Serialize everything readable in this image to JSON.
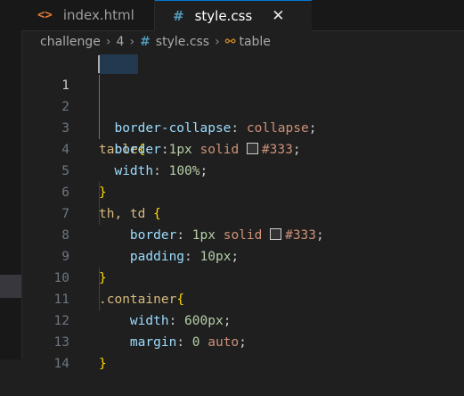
{
  "tabs": [
    {
      "label": "index.html",
      "icon": "html-file-icon",
      "active": false
    },
    {
      "label": "style.css",
      "icon": "css-file-icon",
      "active": true
    }
  ],
  "breadcrumb": {
    "items": [
      "challenge",
      "4",
      "style.css",
      "table"
    ]
  },
  "colors": {
    "selector": "#d7ba7d",
    "property": "#9cdcfe",
    "number": "#b5cea8",
    "string_value": "#ce9178",
    "brace": "#ffd700",
    "swatch": "#333333"
  },
  "editor": {
    "active_line": 1,
    "lines": [
      {
        "n": "1",
        "text": "table{"
      },
      {
        "n": "2",
        "text": "  border-collapse: collapse;"
      },
      {
        "n": "3",
        "text": "  border:1px solid #333;"
      },
      {
        "n": "4",
        "text": "  width: 100%;"
      },
      {
        "n": "5",
        "text": "}"
      },
      {
        "n": "6",
        "text": "th, td {"
      },
      {
        "n": "7",
        "text": "    border: 1px solid #333;"
      },
      {
        "n": "8",
        "text": "    padding: 10px;"
      },
      {
        "n": "9",
        "text": "}"
      },
      {
        "n": "10",
        "text": ".container{"
      },
      {
        "n": "11",
        "text": "    width: 600px;"
      },
      {
        "n": "12",
        "text": "    margin: 0 auto;"
      },
      {
        "n": "13",
        "text": "}"
      },
      {
        "n": "14",
        "text": ""
      }
    ],
    "tokens": {
      "l1": {
        "sel": "table",
        "brace": "{"
      },
      "l2": {
        "prop": "border-collapse",
        "colon": ": ",
        "val": "collapse",
        "semi": ";"
      },
      "l3": {
        "prop": "border",
        "colon": ":",
        "num": "1px",
        "val": " solid ",
        "color": "#333",
        "semi": ";"
      },
      "l4": {
        "prop": "width",
        "colon": ": ",
        "num": "100%",
        "semi": ";"
      },
      "l5": {
        "brace": "}"
      },
      "l6": {
        "sel": "th, td ",
        "brace": "{"
      },
      "l7": {
        "prop": "border",
        "colon": ": ",
        "num": "1px",
        "val": " solid ",
        "color": "#333",
        "semi": ";"
      },
      "l8": {
        "prop": "padding",
        "colon": ": ",
        "num": "10px",
        "semi": ";"
      },
      "l9": {
        "brace": "}"
      },
      "l10": {
        "sel": ".container",
        "brace": "{"
      },
      "l11": {
        "prop": "width",
        "colon": ": ",
        "num": "600px",
        "semi": ";"
      },
      "l12": {
        "prop": "margin",
        "colon": ": ",
        "num": "0",
        "val": " auto",
        "semi": ";"
      },
      "l13": {
        "brace": "}"
      }
    }
  }
}
